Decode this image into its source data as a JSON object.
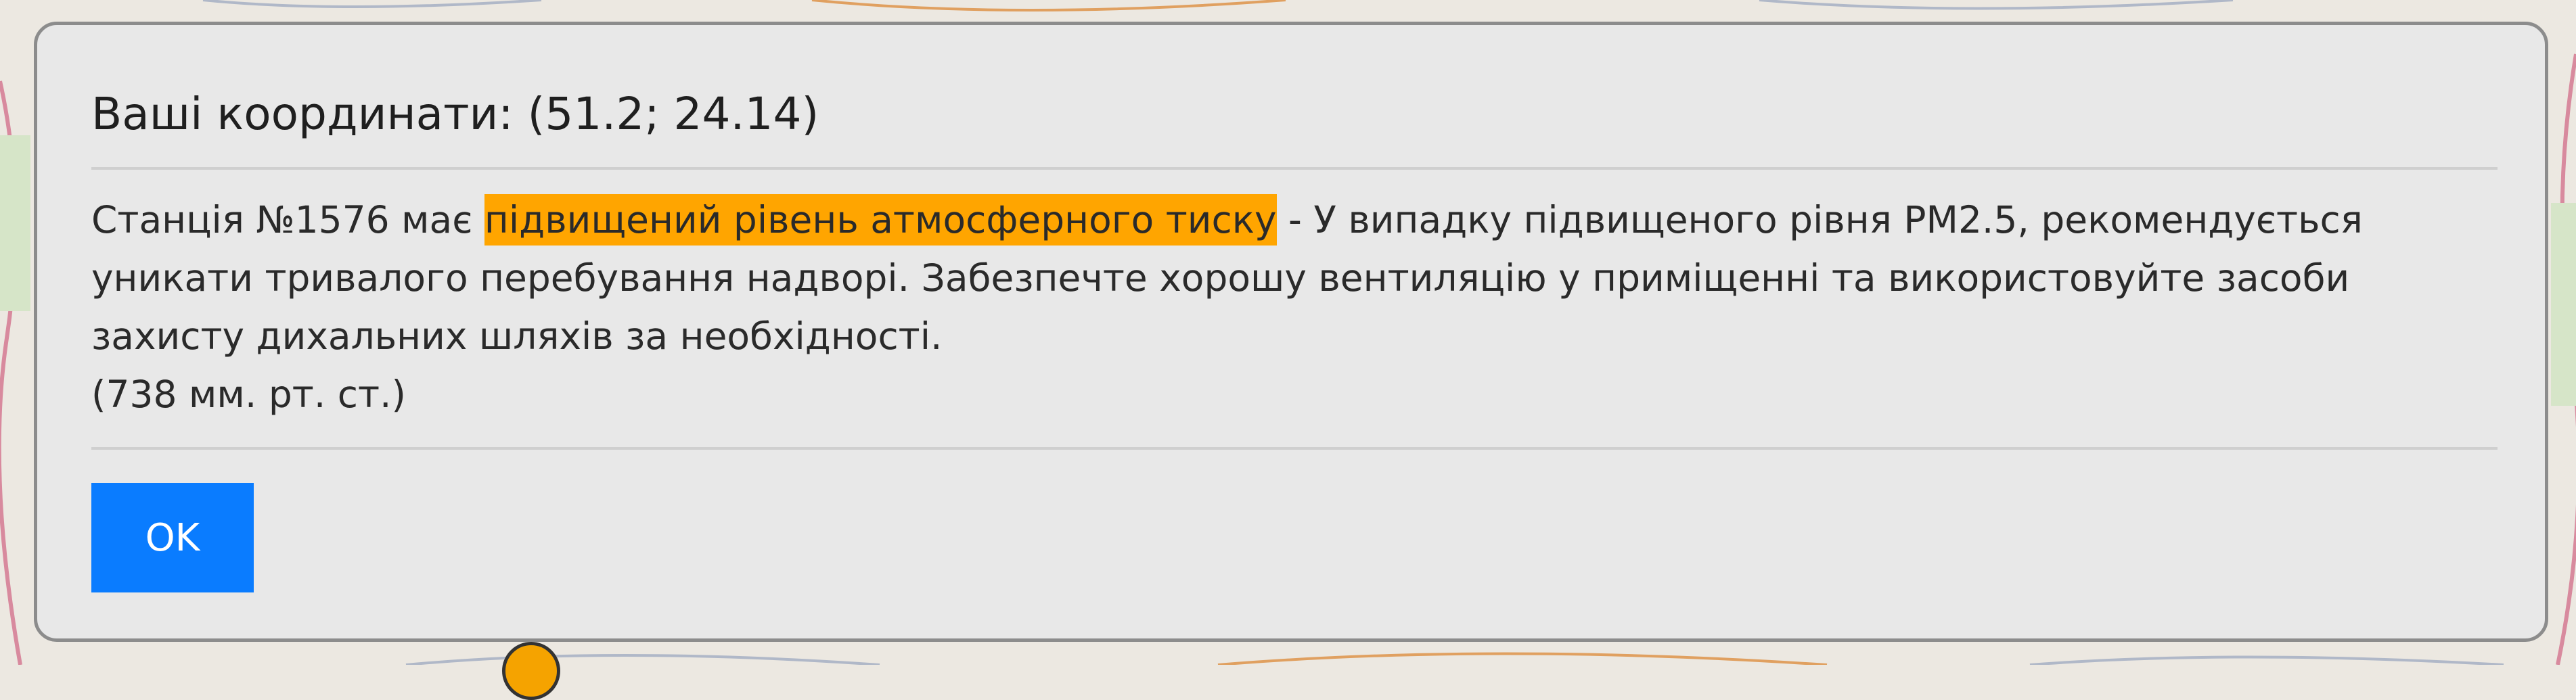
{
  "dialog": {
    "title": "Ваші координати: (51.2; 24.14)",
    "body_prefix": "Станція №1576 має",
    "highlight_text": "підвищений рівень атмосферного тиску",
    "body_suffix": "- У випадку підвищеного рівня PM2.5, рекомендується уникати тривалого перебування надворі. Забезпечте хорошу вентиляцію у приміщенні та використовуйте засоби захисту дихальних шляхів за необхідності.",
    "pressure_value": "(738 мм. рт. ст.)",
    "ok_label": "OK"
  },
  "colors": {
    "highlight": "#ffa500",
    "ok_button": "#0a7cff",
    "station_marker": "#f5a300",
    "dialog_background": "#e8e8e8"
  }
}
